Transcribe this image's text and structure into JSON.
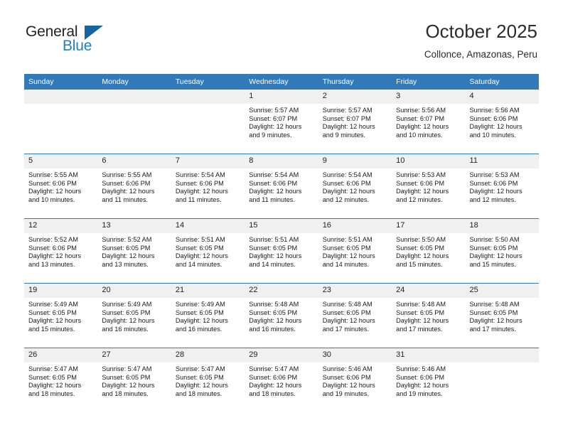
{
  "brand": {
    "name_part1": "General",
    "name_part2": "Blue"
  },
  "header": {
    "title": "October 2025",
    "subtitle": "Collonce, Amazonas, Peru"
  },
  "colors": {
    "header_blue": "#3179b8",
    "brand_blue": "#1f7fc4",
    "daynum_bg": "#f0f0f0"
  },
  "weekday_headers": [
    "Sunday",
    "Monday",
    "Tuesday",
    "Wednesday",
    "Thursday",
    "Friday",
    "Saturday"
  ],
  "weeks": [
    [
      {
        "day": "",
        "sunrise": "",
        "sunset": "",
        "daylight_line1": "",
        "daylight_line2": ""
      },
      {
        "day": "",
        "sunrise": "",
        "sunset": "",
        "daylight_line1": "",
        "daylight_line2": ""
      },
      {
        "day": "",
        "sunrise": "",
        "sunset": "",
        "daylight_line1": "",
        "daylight_line2": ""
      },
      {
        "day": "1",
        "sunrise": "Sunrise: 5:57 AM",
        "sunset": "Sunset: 6:07 PM",
        "daylight_line1": "Daylight: 12 hours",
        "daylight_line2": "and 9 minutes."
      },
      {
        "day": "2",
        "sunrise": "Sunrise: 5:57 AM",
        "sunset": "Sunset: 6:07 PM",
        "daylight_line1": "Daylight: 12 hours",
        "daylight_line2": "and 9 minutes."
      },
      {
        "day": "3",
        "sunrise": "Sunrise: 5:56 AM",
        "sunset": "Sunset: 6:07 PM",
        "daylight_line1": "Daylight: 12 hours",
        "daylight_line2": "and 10 minutes."
      },
      {
        "day": "4",
        "sunrise": "Sunrise: 5:56 AM",
        "sunset": "Sunset: 6:06 PM",
        "daylight_line1": "Daylight: 12 hours",
        "daylight_line2": "and 10 minutes."
      }
    ],
    [
      {
        "day": "5",
        "sunrise": "Sunrise: 5:55 AM",
        "sunset": "Sunset: 6:06 PM",
        "daylight_line1": "Daylight: 12 hours",
        "daylight_line2": "and 10 minutes."
      },
      {
        "day": "6",
        "sunrise": "Sunrise: 5:55 AM",
        "sunset": "Sunset: 6:06 PM",
        "daylight_line1": "Daylight: 12 hours",
        "daylight_line2": "and 11 minutes."
      },
      {
        "day": "7",
        "sunrise": "Sunrise: 5:54 AM",
        "sunset": "Sunset: 6:06 PM",
        "daylight_line1": "Daylight: 12 hours",
        "daylight_line2": "and 11 minutes."
      },
      {
        "day": "8",
        "sunrise": "Sunrise: 5:54 AM",
        "sunset": "Sunset: 6:06 PM",
        "daylight_line1": "Daylight: 12 hours",
        "daylight_line2": "and 11 minutes."
      },
      {
        "day": "9",
        "sunrise": "Sunrise: 5:54 AM",
        "sunset": "Sunset: 6:06 PM",
        "daylight_line1": "Daylight: 12 hours",
        "daylight_line2": "and 12 minutes."
      },
      {
        "day": "10",
        "sunrise": "Sunrise: 5:53 AM",
        "sunset": "Sunset: 6:06 PM",
        "daylight_line1": "Daylight: 12 hours",
        "daylight_line2": "and 12 minutes."
      },
      {
        "day": "11",
        "sunrise": "Sunrise: 5:53 AM",
        "sunset": "Sunset: 6:06 PM",
        "daylight_line1": "Daylight: 12 hours",
        "daylight_line2": "and 12 minutes."
      }
    ],
    [
      {
        "day": "12",
        "sunrise": "Sunrise: 5:52 AM",
        "sunset": "Sunset: 6:06 PM",
        "daylight_line1": "Daylight: 12 hours",
        "daylight_line2": "and 13 minutes."
      },
      {
        "day": "13",
        "sunrise": "Sunrise: 5:52 AM",
        "sunset": "Sunset: 6:05 PM",
        "daylight_line1": "Daylight: 12 hours",
        "daylight_line2": "and 13 minutes."
      },
      {
        "day": "14",
        "sunrise": "Sunrise: 5:51 AM",
        "sunset": "Sunset: 6:05 PM",
        "daylight_line1": "Daylight: 12 hours",
        "daylight_line2": "and 14 minutes."
      },
      {
        "day": "15",
        "sunrise": "Sunrise: 5:51 AM",
        "sunset": "Sunset: 6:05 PM",
        "daylight_line1": "Daylight: 12 hours",
        "daylight_line2": "and 14 minutes."
      },
      {
        "day": "16",
        "sunrise": "Sunrise: 5:51 AM",
        "sunset": "Sunset: 6:05 PM",
        "daylight_line1": "Daylight: 12 hours",
        "daylight_line2": "and 14 minutes."
      },
      {
        "day": "17",
        "sunrise": "Sunrise: 5:50 AM",
        "sunset": "Sunset: 6:05 PM",
        "daylight_line1": "Daylight: 12 hours",
        "daylight_line2": "and 15 minutes."
      },
      {
        "day": "18",
        "sunrise": "Sunrise: 5:50 AM",
        "sunset": "Sunset: 6:05 PM",
        "daylight_line1": "Daylight: 12 hours",
        "daylight_line2": "and 15 minutes."
      }
    ],
    [
      {
        "day": "19",
        "sunrise": "Sunrise: 5:49 AM",
        "sunset": "Sunset: 6:05 PM",
        "daylight_line1": "Daylight: 12 hours",
        "daylight_line2": "and 15 minutes."
      },
      {
        "day": "20",
        "sunrise": "Sunrise: 5:49 AM",
        "sunset": "Sunset: 6:05 PM",
        "daylight_line1": "Daylight: 12 hours",
        "daylight_line2": "and 16 minutes."
      },
      {
        "day": "21",
        "sunrise": "Sunrise: 5:49 AM",
        "sunset": "Sunset: 6:05 PM",
        "daylight_line1": "Daylight: 12 hours",
        "daylight_line2": "and 16 minutes."
      },
      {
        "day": "22",
        "sunrise": "Sunrise: 5:48 AM",
        "sunset": "Sunset: 6:05 PM",
        "daylight_line1": "Daylight: 12 hours",
        "daylight_line2": "and 16 minutes."
      },
      {
        "day": "23",
        "sunrise": "Sunrise: 5:48 AM",
        "sunset": "Sunset: 6:05 PM",
        "daylight_line1": "Daylight: 12 hours",
        "daylight_line2": "and 17 minutes."
      },
      {
        "day": "24",
        "sunrise": "Sunrise: 5:48 AM",
        "sunset": "Sunset: 6:05 PM",
        "daylight_line1": "Daylight: 12 hours",
        "daylight_line2": "and 17 minutes."
      },
      {
        "day": "25",
        "sunrise": "Sunrise: 5:48 AM",
        "sunset": "Sunset: 6:05 PM",
        "daylight_line1": "Daylight: 12 hours",
        "daylight_line2": "and 17 minutes."
      }
    ],
    [
      {
        "day": "26",
        "sunrise": "Sunrise: 5:47 AM",
        "sunset": "Sunset: 6:05 PM",
        "daylight_line1": "Daylight: 12 hours",
        "daylight_line2": "and 18 minutes."
      },
      {
        "day": "27",
        "sunrise": "Sunrise: 5:47 AM",
        "sunset": "Sunset: 6:05 PM",
        "daylight_line1": "Daylight: 12 hours",
        "daylight_line2": "and 18 minutes."
      },
      {
        "day": "28",
        "sunrise": "Sunrise: 5:47 AM",
        "sunset": "Sunset: 6:05 PM",
        "daylight_line1": "Daylight: 12 hours",
        "daylight_line2": "and 18 minutes."
      },
      {
        "day": "29",
        "sunrise": "Sunrise: 5:47 AM",
        "sunset": "Sunset: 6:06 PM",
        "daylight_line1": "Daylight: 12 hours",
        "daylight_line2": "and 18 minutes."
      },
      {
        "day": "30",
        "sunrise": "Sunrise: 5:46 AM",
        "sunset": "Sunset: 6:06 PM",
        "daylight_line1": "Daylight: 12 hours",
        "daylight_line2": "and 19 minutes."
      },
      {
        "day": "31",
        "sunrise": "Sunrise: 5:46 AM",
        "sunset": "Sunset: 6:06 PM",
        "daylight_line1": "Daylight: 12 hours",
        "daylight_line2": "and 19 minutes."
      },
      {
        "day": "",
        "sunrise": "",
        "sunset": "",
        "daylight_line1": "",
        "daylight_line2": ""
      }
    ]
  ]
}
